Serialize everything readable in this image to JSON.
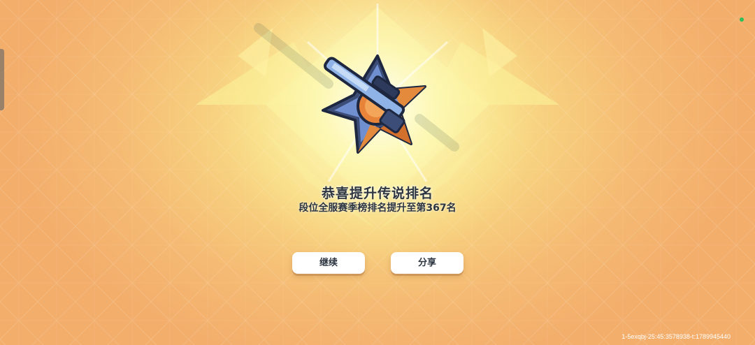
{
  "dialog": {
    "title": "恭喜提升传说排名",
    "subtitle": "段位全服赛季榜排名提升至第367名"
  },
  "buttons": {
    "continue_label": "继续",
    "share_label": "分享"
  },
  "footer": {
    "id_text": "1-5exqbj-25:45:3578938-t:1789945440"
  },
  "emblem": {
    "icon": "sniper-rifle-star-badge-icon"
  },
  "colors": {
    "text": "#2c3540",
    "button_bg": "#ffffff",
    "bg_center": "#fbf6a8",
    "bg_edge": "#f3ae6c",
    "status_dot": "#2fbf5a"
  }
}
